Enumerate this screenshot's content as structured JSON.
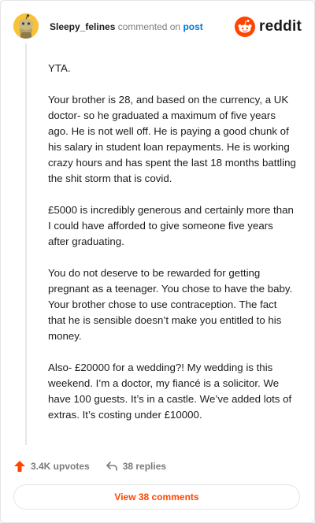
{
  "header": {
    "username": "Sleepy_felines",
    "action_text": " commented on ",
    "post_link": "post",
    "logo_text": "reddit"
  },
  "comment": {
    "paragraphs": [
      "YTA.",
      "Your brother is 28, and based on the currency, a UK doctor- so he graduated a maximum of five years ago. He is not well off. He is paying a good chunk of his salary in student loan repayments. He is working crazy hours and has spent the last 18 months battling the shit storm that is covid.",
      "£5000 is incredibly generous and certainly more than I could have afforded to give someone five years after graduating.",
      "You do not deserve to be rewarded for getting pregnant as a teenager. You chose to have the baby. Your brother chose to use contraception. The fact that he is sensible doesn’t make you entitled to his money.",
      "Also- £20000 for a wedding?! My wedding is this weekend. I’m a doctor, my fiancé is a solicitor. We have 100 guests. It’s in a castle. We’ve added lots of extras. It’s costing under £10000."
    ]
  },
  "footer": {
    "upvotes": "3.4K upvotes",
    "replies": "38 replies",
    "view_comments": "View 38 comments"
  },
  "colors": {
    "accent": "#ff4500",
    "link": "#0079d3",
    "avatar": "#f7c23a"
  },
  "icons": {
    "avatar": "snoo-avatar-icon",
    "logo": "reddit-logo-icon",
    "upvote": "upvote-arrow-icon",
    "reply": "reply-arrow-icon"
  }
}
